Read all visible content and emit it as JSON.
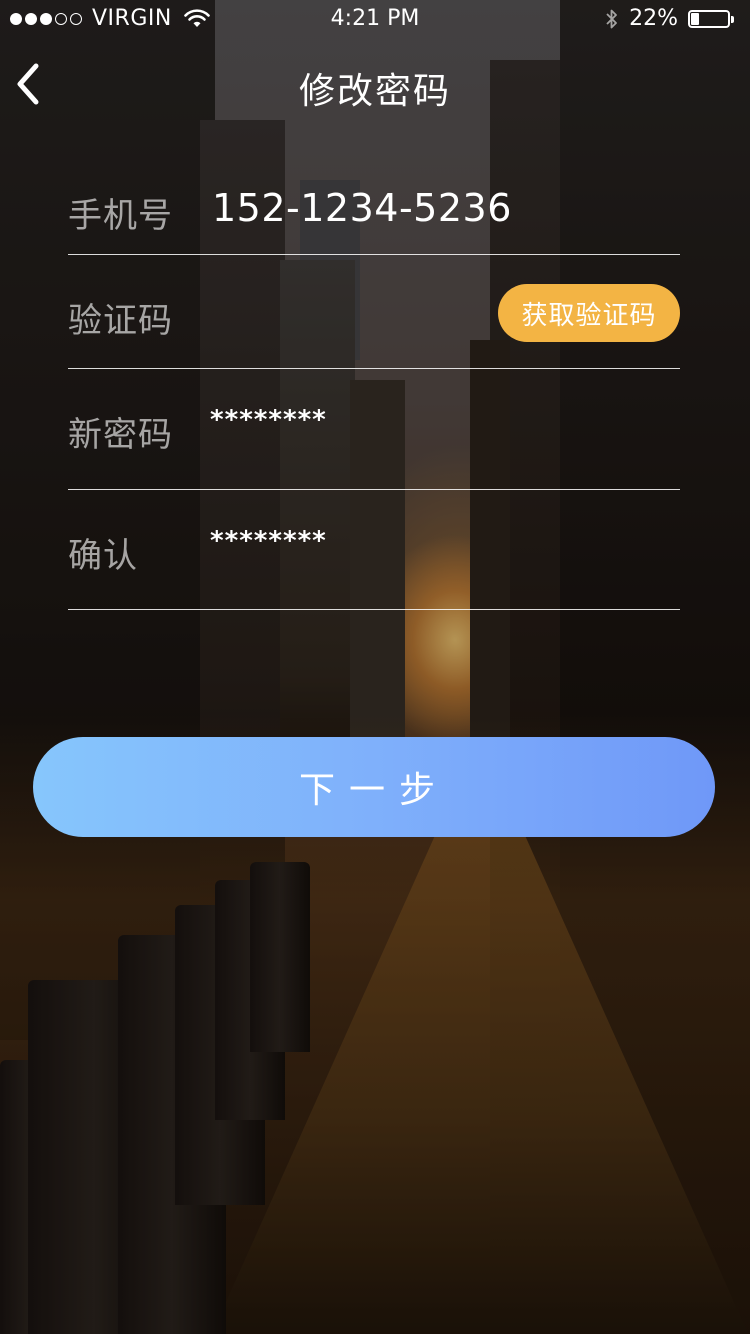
{
  "status_bar": {
    "carrier": "VIRGIN",
    "time": "4:21 PM",
    "battery": "22%",
    "battery_level": 0.22
  },
  "nav": {
    "title": "修改密码",
    "back_icon": "chevron-left-icon"
  },
  "form": {
    "phone": {
      "label": "手机号",
      "value": "152-1234-5236"
    },
    "code": {
      "label": "验证码",
      "button_label": "获取验证码"
    },
    "new_password": {
      "label": "新密码",
      "value": "********"
    },
    "confirm_password": {
      "label": "确认",
      "value": "********"
    }
  },
  "next_button": {
    "label": "下一步"
  },
  "colors": {
    "accent_orange": "#f3b444",
    "button_blue_start": "#86c6fc",
    "button_blue_end": "#6f98f8"
  }
}
